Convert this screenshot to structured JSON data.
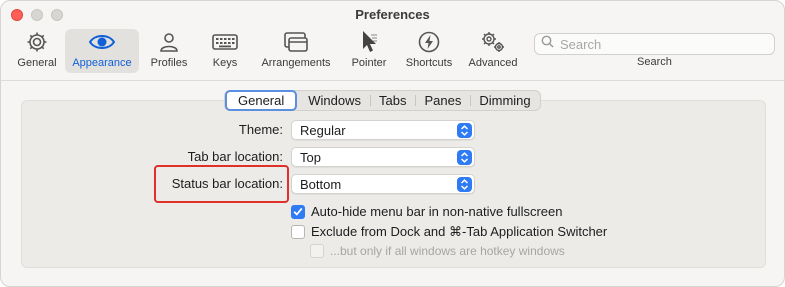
{
  "window": {
    "title": "Preferences"
  },
  "toolbar": {
    "items": [
      {
        "label": "General",
        "icon": "gear-icon"
      },
      {
        "label": "Appearance",
        "icon": "eye-icon"
      },
      {
        "label": "Profiles",
        "icon": "person-icon"
      },
      {
        "label": "Keys",
        "icon": "keyboard-icon"
      },
      {
        "label": "Arrangements",
        "icon": "windows-icon"
      },
      {
        "label": "Pointer",
        "icon": "pointer-icon"
      },
      {
        "label": "Shortcuts",
        "icon": "bolt-icon"
      },
      {
        "label": "Advanced",
        "icon": "gears-icon"
      }
    ],
    "selected": "Appearance",
    "search_placeholder": "Search",
    "search_label": "Search"
  },
  "tabs": {
    "items": [
      "General",
      "Windows",
      "Tabs",
      "Panes",
      "Dimming"
    ],
    "active": "General"
  },
  "form": {
    "theme_label": "Theme:",
    "theme_value": "Regular",
    "tabbar_label": "Tab bar location:",
    "tabbar_value": "Top",
    "statusbar_label": "Status bar location:",
    "statusbar_value": "Bottom"
  },
  "options": {
    "autohide_label": "Auto-hide menu bar in non-native fullscreen",
    "autohide_checked": true,
    "exclude_label": "Exclude from Dock and ⌘-Tab Application Switcher",
    "exclude_checked": false,
    "hotkey_label": "...but only if all windows are hotkey windows",
    "hotkey_checked": false,
    "hotkey_enabled": false
  },
  "colors": {
    "accent": "#2f7bf6",
    "selected_tab_text": "#1060d8",
    "highlight_border": "#e0302a"
  }
}
